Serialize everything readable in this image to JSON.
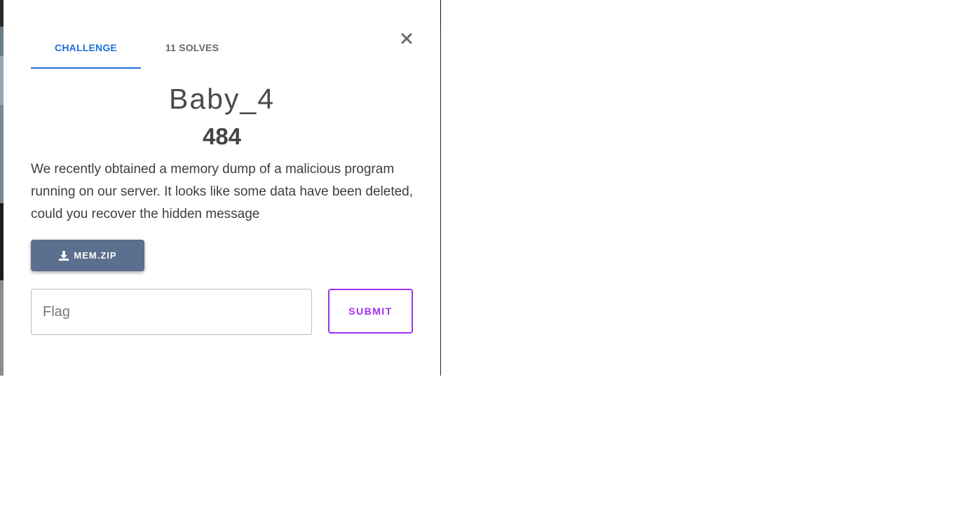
{
  "tabs": [
    {
      "label": "CHALLENGE",
      "active": true
    },
    {
      "label": "11 SOLVES",
      "active": false
    }
  ],
  "close": {
    "symbol": "×",
    "icon": "close-icon"
  },
  "challenge": {
    "title": "Baby_4",
    "points": "484",
    "description": "We recently obtained a memory dump of a malicious program running on our server. It looks like some data have been deleted, could you recover the hidden message"
  },
  "download": {
    "label": "MEM.ZIP",
    "icon": "download-icon"
  },
  "flag": {
    "placeholder": "Flag",
    "value": ""
  },
  "submit": {
    "label": "SUBMIT"
  },
  "colors": {
    "tab_active": "#1e6fd9",
    "download_bg": "#5b6f8e",
    "submit_accent": "#a12ef0"
  }
}
